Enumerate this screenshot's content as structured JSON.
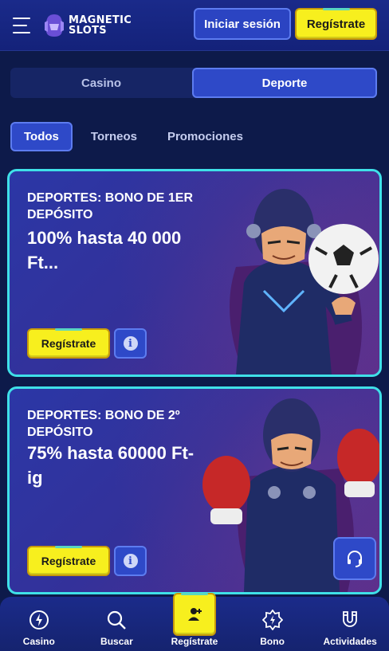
{
  "header": {
    "logo_line1": "MAGNETIC",
    "logo_line2": "SLOTS",
    "login_label": "Iniciar sesión",
    "register_label": "Regístrate"
  },
  "switch": {
    "casino_label": "Casino",
    "sport_label": "Deporte",
    "active": "Deporte"
  },
  "filters": [
    {
      "label": "Todos",
      "active": true
    },
    {
      "label": "Torneos",
      "active": false
    },
    {
      "label": "Promociones",
      "active": false
    }
  ],
  "promos": [
    {
      "title": "DEPORTES: BONO DE 1ER DEPÓSITO",
      "amount": "100% hasta 40 000 Ft...",
      "button_label": "Regístrate",
      "hero_icon": "soccer-ball-icon"
    },
    {
      "title": "DEPORTES: BONO DE 2º DEPÓSITO",
      "amount": "75% hasta 60000 Ft-ig",
      "button_label": "Regístrate",
      "hero_icon": "boxing-gloves-icon"
    }
  ],
  "bottom_nav": [
    {
      "label": "Casino",
      "icon": "casino-chip-icon"
    },
    {
      "label": "Buscar",
      "icon": "search-icon"
    },
    {
      "label": "Regístrate",
      "icon": "user-plus-icon"
    },
    {
      "label": "Bono",
      "icon": "bonus-badge-icon"
    },
    {
      "label": "Actividades",
      "icon": "magnet-icon"
    }
  ],
  "colors": {
    "accent_yellow": "#f7ef1e",
    "accent_blue": "#2e49c8",
    "card_border": "#3fe0e8"
  }
}
